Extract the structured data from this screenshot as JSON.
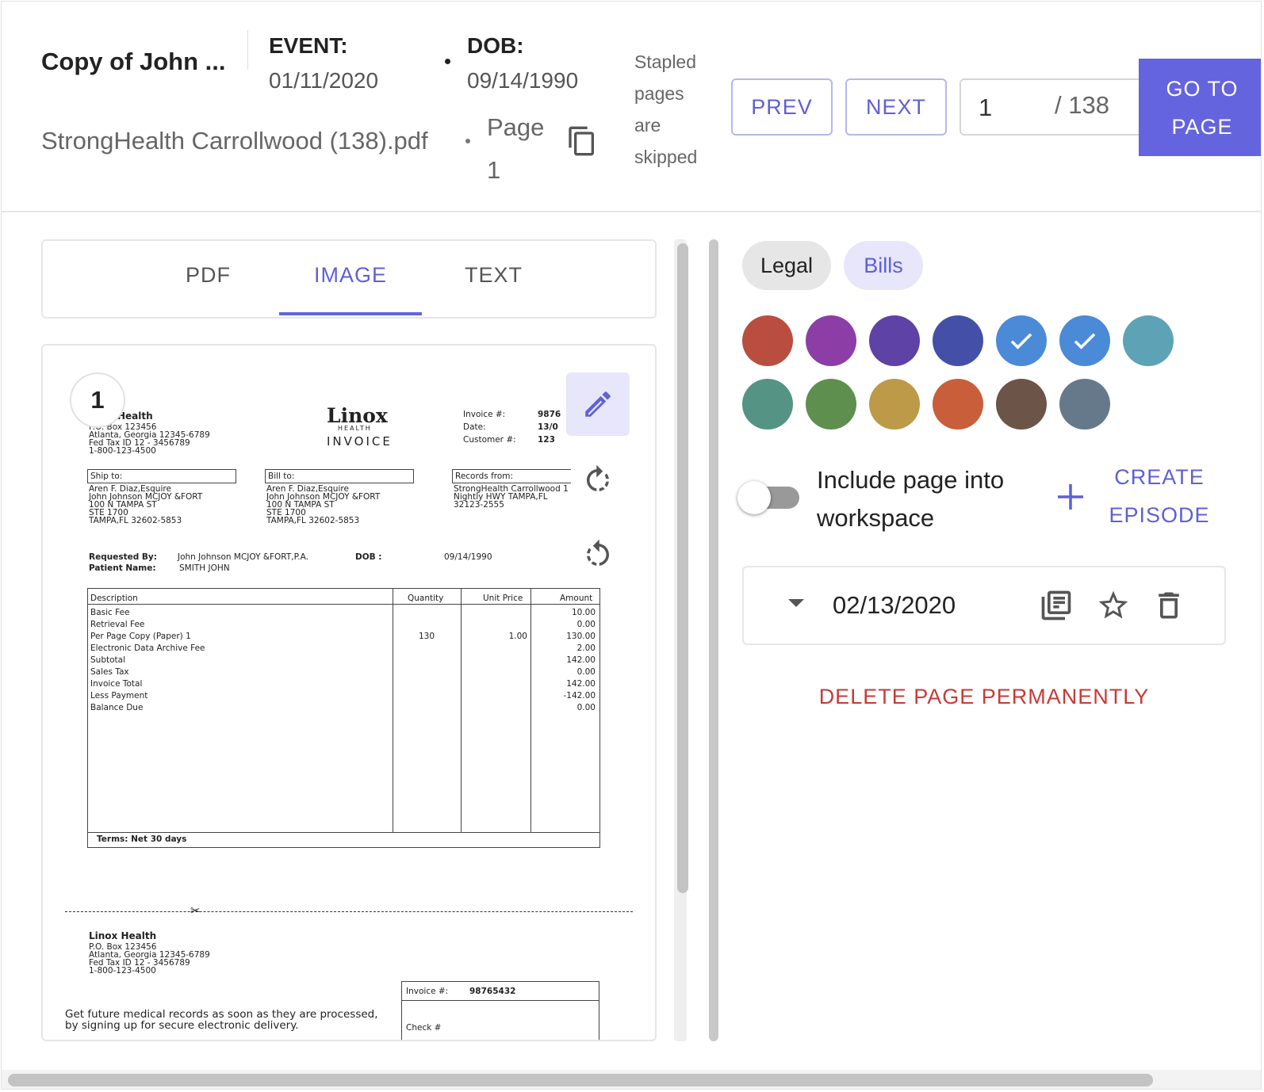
{
  "header": {
    "doc_title": "Copy of John ...",
    "event_label": "EVENT:",
    "event_value": "01/11/2020",
    "dob_label": "DOB:",
    "dob_value": "09/14/1990",
    "file_name": "StrongHealth Carrollwood (138).pdf",
    "page_label": "Page 1",
    "stapled_note": "Stapled pages are skipped",
    "prev_label": "PREV",
    "next_label": "NEXT",
    "page_input_value": "1",
    "page_total": "/ 138",
    "goto_label": "GO TO PAGE"
  },
  "viewer": {
    "tabs": [
      {
        "label": "PDF"
      },
      {
        "label": "IMAGE",
        "active": true
      },
      {
        "label": "TEXT"
      }
    ],
    "page_number": "1",
    "icons": {
      "edit": "pencil-icon",
      "rotate_cw": "rotate-clockwise-icon",
      "rotate_ccw": "rotate-counterclockwise-icon"
    }
  },
  "invoice": {
    "company_name_partial": "Health",
    "address_lines": [
      "P.O. Box 123456",
      "Atlanta, Georgia 12345-6789",
      "Fed Tax ID 12 - 3456789",
      "1-800-123-4500"
    ],
    "logo_main": "Linox",
    "logo_sub": "HEALTH",
    "logo_title": "INVOICE",
    "meta_labels": [
      "Invoice #:",
      "Date:",
      "Customer #:"
    ],
    "meta_values": [
      "9876",
      "13/0",
      "123"
    ],
    "ship_to_label": "Ship to:",
    "ship_to_lines": [
      "Aren F. Diaz,Esquire",
      "John Johnson  MCJOY &FORT",
      "100 N TAMPA ST",
      "STE 1700",
      "TAMPA,FL 32602-5853"
    ],
    "bill_to_label": "Bill to:",
    "bill_to_lines": [
      "Aren F. Diaz,Esquire",
      "John Johnson  MCJOY &FORT",
      "100 N TAMPA ST",
      "STE 1700",
      "TAMPA,FL 32602-5853"
    ],
    "records_from_label": "Records from:",
    "records_from_lines": [
      "StrongHealth Carrollwood 1",
      "Nightly  HWY TAMPA,FL",
      "32123-2555"
    ],
    "requested_by_label": "Requested By:",
    "requested_by_value": "John Johnson  MCJOY &FORT,P.A.",
    "patient_name_label": "Patient Name:",
    "patient_name_value": "SMITH JOHN",
    "dob_label": "DOB :",
    "dob_value": "09/14/1990",
    "table_headers": [
      "Description",
      "Quantity",
      "Unit Price",
      "Amount"
    ],
    "rows": [
      {
        "desc": "Basic Fee",
        "qty": "",
        "unit": "",
        "amount": "10.00"
      },
      {
        "desc": "Retrieval Fee",
        "qty": "",
        "unit": "",
        "amount": "0.00"
      },
      {
        "desc": "Per Page Copy (Paper) 1",
        "qty": "130",
        "unit": "1.00",
        "amount": "130.00"
      },
      {
        "desc": "Electronic Data Archive Fee",
        "qty": "",
        "unit": "",
        "amount": "2.00"
      },
      {
        "desc": "Subtotal",
        "qty": "",
        "unit": "",
        "amount": "142.00"
      },
      {
        "desc": "Sales Tax",
        "qty": "",
        "unit": "",
        "amount": "0.00"
      },
      {
        "desc": "Invoice Total",
        "qty": "",
        "unit": "",
        "amount": "142.00"
      },
      {
        "desc": "Less Payment",
        "qty": "",
        "unit": "",
        "amount": "-142.00"
      },
      {
        "desc": "Balance Due",
        "qty": "",
        "unit": "",
        "amount": "0.00"
      }
    ],
    "terms": "Terms: Net 30 days",
    "stub_company": "Linox Health",
    "stub_address_lines": [
      "P.O. Box 123456",
      "Atlanta, Georgia 12345-6789",
      "Fed Tax ID 12 - 3456789",
      "1-800-123-4500"
    ],
    "stub_invoice_label": "Invoice #:",
    "stub_invoice_value": "98765432",
    "stub_check_label": "Check #",
    "stub_message_1": "Get future medical records as soon as they are processed,",
    "stub_message_2": "by signing up for secure electronic delivery."
  },
  "side": {
    "chips": [
      {
        "label": "Legal",
        "selected": false
      },
      {
        "label": "Bills",
        "selected": true
      }
    ],
    "swatches": [
      {
        "color": "#b94e40",
        "checked": false
      },
      {
        "color": "#8c3ea6",
        "checked": false
      },
      {
        "color": "#5e42a6",
        "checked": false
      },
      {
        "color": "#4450a8",
        "checked": false
      },
      {
        "color": "#4a8ad6",
        "checked": true
      },
      {
        "color": "#4a8ad6",
        "checked": true
      },
      {
        "color": "#5ea2b5",
        "checked": false
      },
      {
        "color": "#559485",
        "checked": false
      },
      {
        "color": "#5e8f4f",
        "checked": false
      },
      {
        "color": "#bc9a48",
        "checked": false
      },
      {
        "color": "#c85f3a",
        "checked": false
      },
      {
        "color": "#6d5449",
        "checked": false
      },
      {
        "color": "#66798b",
        "checked": false
      }
    ],
    "include_label": "Include page into workspace",
    "include_checked": false,
    "create_episode_label": "CREATE EPISODE",
    "episode_date": "02/13/2020",
    "delete_label": "DELETE PAGE PERMANENTLY"
  },
  "colors": {
    "accent": "#6464de",
    "accent_text": "#5f5fd8",
    "danger": "#c83a37"
  }
}
